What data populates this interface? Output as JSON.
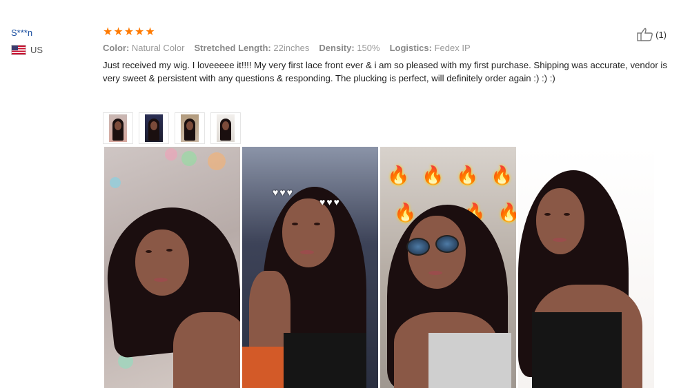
{
  "reviewer": {
    "name": "S***n",
    "country": "US"
  },
  "review": {
    "rating": 5,
    "attributes": [
      {
        "label": "Color:",
        "value": "Natural Color"
      },
      {
        "label": "Stretched Length:",
        "value": "22inches"
      },
      {
        "label": "Density:",
        "value": "150%"
      },
      {
        "label": "Logistics:",
        "value": "Fedex IP"
      }
    ],
    "text": "Just received my wig. I loveeeee it!!!! My very first lace front ever & i am so pleased with my first purchase. Shipping was accurate, vendor is very sweet & persistent with any questions & responding. The plucking is perfect, will definitely order again :) :) :)",
    "helpful_count": "(1)"
  },
  "colors": {
    "accent_star": "#ff7a00",
    "username": "#1a4fa0"
  },
  "icons": {
    "flag": "us-flag-icon",
    "helpful": "thumbs-up-icon",
    "star": "star-icon"
  },
  "thumbnails": 4,
  "photos": 4
}
